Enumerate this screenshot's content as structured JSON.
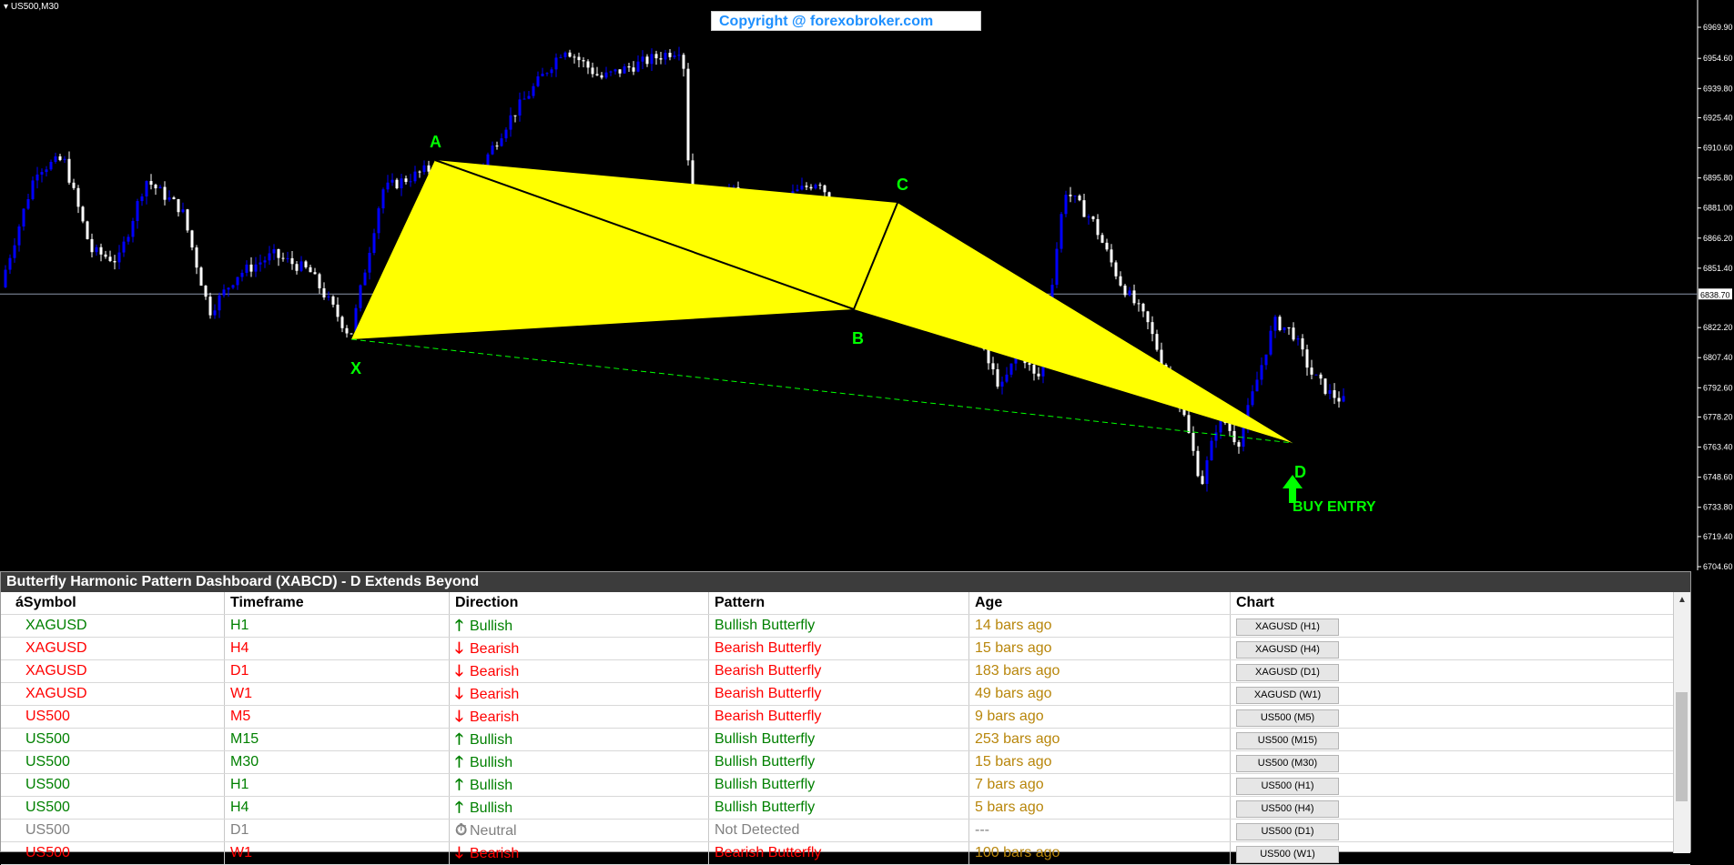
{
  "chart": {
    "symbol_label": "US500,M30",
    "copyright": "Copyright @ forexobroker.com",
    "current_price": "6838.70",
    "price_axis": [
      "6969.90",
      "6954.60",
      "6939.80",
      "6925.40",
      "6910.60",
      "6895.80",
      "6881.00",
      "6866.20",
      "6851.40",
      "6822.20",
      "6807.40",
      "6792.60",
      "6778.20",
      "6763.40",
      "6748.60",
      "6733.80",
      "6719.40",
      "6704.60"
    ],
    "axis_zero": "0",
    "pattern_labels": {
      "X": "X",
      "A": "A",
      "B": "B",
      "C": "C",
      "D": "D"
    },
    "entry_label": "BUY ENTRY",
    "colors": {
      "pattern_fill": "#ffff00",
      "bull_candle": "#0000ff",
      "bear_candle": "#ffffff",
      "label": "#00ff00",
      "background": "#000000"
    }
  },
  "dashboard": {
    "title": "Butterfly Harmonic Pattern Dashboard (XABCD) - D Extends Beyond",
    "headers": {
      "symbol": "áSymbol",
      "timeframe": "Timeframe",
      "direction": "Direction",
      "pattern": "Pattern",
      "age": "Age",
      "chart": "Chart"
    },
    "colors": {
      "bullish": "#008000",
      "bearish": "#ff0000",
      "neutral": "#808080",
      "age": "#b8860b"
    },
    "rows": [
      {
        "symbol": "XAGUSD",
        "timeframe": "H1",
        "direction": "Bullish",
        "pattern": "Bullish Butterfly",
        "age": "14 bars ago",
        "chart": "XAGUSD (H1)"
      },
      {
        "symbol": "XAGUSD",
        "timeframe": "H4",
        "direction": "Bearish",
        "pattern": "Bearish Butterfly",
        "age": "15 bars ago",
        "chart": "XAGUSD (H4)"
      },
      {
        "symbol": "XAGUSD",
        "timeframe": "D1",
        "direction": "Bearish",
        "pattern": "Bearish Butterfly",
        "age": "183 bars ago",
        "chart": "XAGUSD (D1)"
      },
      {
        "symbol": "XAGUSD",
        "timeframe": "W1",
        "direction": "Bearish",
        "pattern": "Bearish Butterfly",
        "age": "49 bars ago",
        "chart": "XAGUSD (W1)"
      },
      {
        "symbol": "US500",
        "timeframe": "M5",
        "direction": "Bearish",
        "pattern": "Bearish Butterfly",
        "age": "9 bars ago",
        "chart": "US500 (M5)"
      },
      {
        "symbol": "US500",
        "timeframe": "M15",
        "direction": "Bullish",
        "pattern": "Bullish Butterfly",
        "age": "253 bars ago",
        "chart": "US500 (M15)"
      },
      {
        "symbol": "US500",
        "timeframe": "M30",
        "direction": "Bullish",
        "pattern": "Bullish Butterfly",
        "age": "15 bars ago",
        "chart": "US500 (M30)"
      },
      {
        "symbol": "US500",
        "timeframe": "H1",
        "direction": "Bullish",
        "pattern": "Bullish Butterfly",
        "age": "7 bars ago",
        "chart": "US500 (H1)"
      },
      {
        "symbol": "US500",
        "timeframe": "H4",
        "direction": "Bullish",
        "pattern": "Bullish Butterfly",
        "age": "5 bars ago",
        "chart": "US500 (H4)"
      },
      {
        "symbol": "US500",
        "timeframe": "D1",
        "direction": "Neutral",
        "pattern": "Not Detected",
        "age": "---",
        "chart": "US500 (D1)"
      },
      {
        "symbol": "US500",
        "timeframe": "W1",
        "direction": "Bearish",
        "pattern": "Bearish Butterfly",
        "age": "100 bars ago",
        "chart": "US500 (W1)"
      }
    ]
  }
}
